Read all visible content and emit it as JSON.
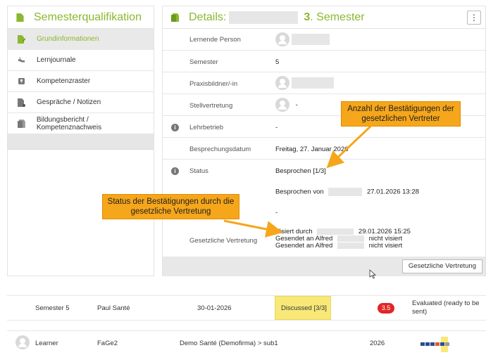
{
  "left_panel": {
    "title": "Semesterqualifikation",
    "items": [
      {
        "label": "Grundinformationen",
        "icon": "page-edit-icon",
        "active": true
      },
      {
        "label": "Lernjournale",
        "icon": "hands-icon"
      },
      {
        "label": "Kompetenzraster",
        "icon": "grid-icon"
      },
      {
        "label": "Gespräche / Notizen",
        "icon": "notes-icon"
      },
      {
        "label": "Bildungsbericht / Kompetenznachweis",
        "icon": "report-icon"
      }
    ]
  },
  "details": {
    "title": "Details:",
    "semester_num": "3",
    "semester_word": ". Semester",
    "menu_icon": "kebab-icon"
  },
  "fields": {
    "lernende_person": "Lernende Person",
    "semester_label": "Semester",
    "semester_value": "5",
    "praxisbildner": "Praxisbildner/-in",
    "stellvertretung": "Stellvertretung",
    "stellvertretung_value": "-",
    "lehrbetrieb": "Lehrbetrieb",
    "lehrbetrieb_value": "-",
    "besprechungsdatum": "Besprechungsdatum",
    "besprechungsdatum_value": "Freitag, 27. Januar 2026",
    "status": "Status",
    "status_value": "Besprochen [1/3]",
    "besprochen_von": "Besprochen von",
    "besprochen_date": "27.01.2026 13:28",
    "dash": "-",
    "gesetzliche_vertretung": "Gesetzliche Vertretung",
    "visiert_durch": "Visiert durch",
    "visiert_date": "29.01.2026 15:25",
    "gesendet_1": "Gesendet an Alfred",
    "nicht_visiert_1": "nicht visiert",
    "gesendet_2": "Gesendet an Alfred",
    "nicht_visiert_2": "nicht visiert",
    "button": "Gesetzliche Vertretung"
  },
  "callouts": {
    "anzahl": "Anzahl der Bestätigungen der gesetzlichen Vertreter",
    "status": "Status der Bestätigungen durch die gesetzliche Vertretung"
  },
  "list_row_1": {
    "semester": "Semester 5",
    "name": "Paul Santé",
    "date": "30-01-2026",
    "status": "Discussed [3/3]",
    "score": "3.5",
    "evaluated": "Evaluated (ready to be sent)"
  },
  "list_row_2": {
    "role": "Learner",
    "class": "FaGe2",
    "company": "Demo Santé (Demofirma) > sub1",
    "year": "2026"
  },
  "colors": {
    "accent_green": "#8ab82e",
    "callout_orange": "#f6a61a",
    "badge_red": "#e02626",
    "highlight_yellow": "#f7e878"
  }
}
